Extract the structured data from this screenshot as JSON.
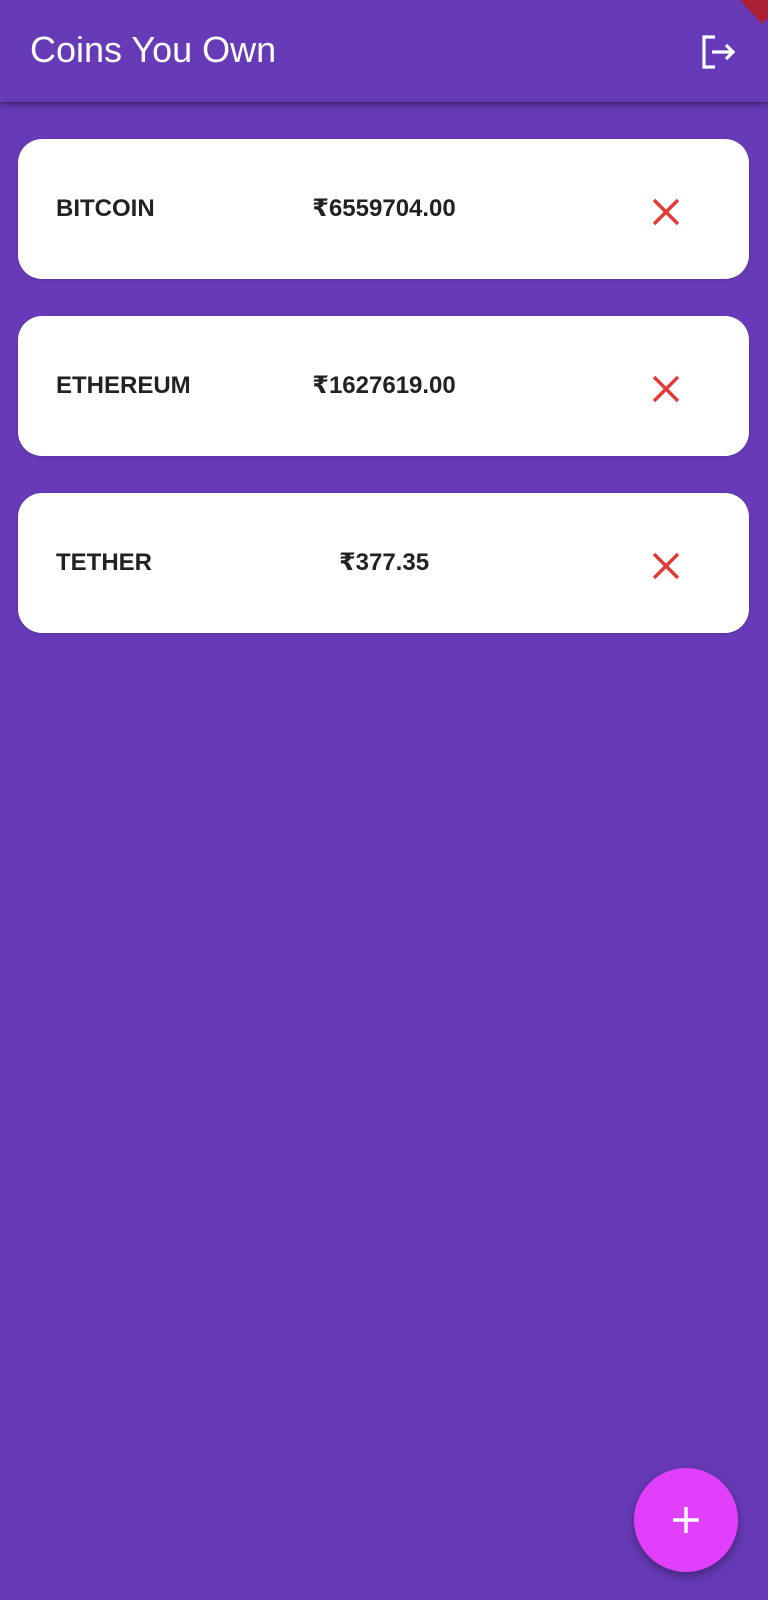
{
  "app_bar": {
    "title": "Coins You Own",
    "logout_icon": "logout-icon"
  },
  "coins": [
    {
      "name": "BITCOIN",
      "value": "₹6559704.00",
      "delete_icon": "close-icon"
    },
    {
      "name": "ETHEREUM",
      "value": "₹1627619.00",
      "delete_icon": "close-icon"
    },
    {
      "name": "TETHER",
      "value": "₹377.35",
      "delete_icon": "close-icon"
    }
  ],
  "fab": {
    "icon": "plus-icon"
  },
  "colors": {
    "background": "#673AB7",
    "card": "#FFFFFF",
    "text": "#222222",
    "delete": "#E53935",
    "fab": "#E040FB",
    "debug_banner": "#B71C1C"
  }
}
